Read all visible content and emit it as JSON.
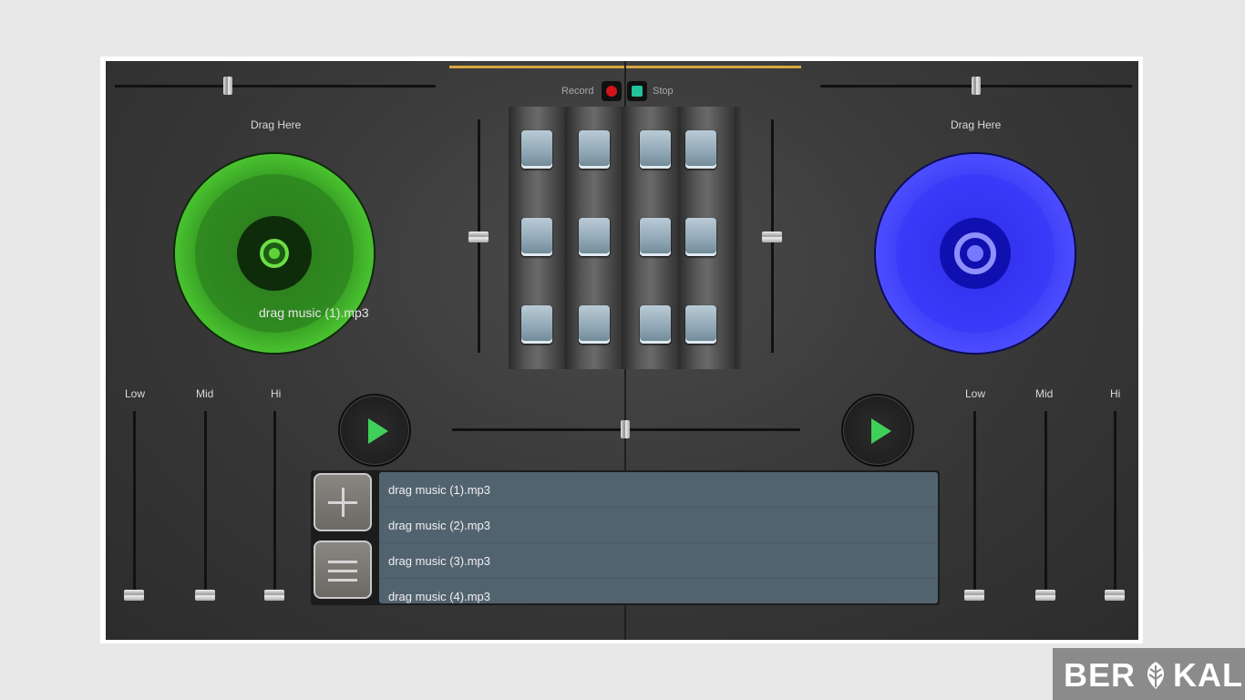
{
  "deck_left": {
    "drag_label": "Drag Here",
    "track_name": "drag music (1).mp3",
    "disc_color": "#3aa226"
  },
  "deck_right": {
    "drag_label": "Drag Here",
    "disc_color": "#3a3afa"
  },
  "controls": {
    "record_label": "Record",
    "stop_label": "Stop",
    "record_color": "#d2141a",
    "stop_color": "#22c39a"
  },
  "eq_left": {
    "low": "Low",
    "mid": "Mid",
    "hi": "Hi"
  },
  "eq_right": {
    "low": "Low",
    "mid": "Mid",
    "hi": "Hi"
  },
  "playlist": {
    "items": [
      "drag music (1).mp3",
      "drag music (2).mp3",
      "drag music (3).mp3",
      "drag music (4).mp3"
    ]
  },
  "watermark": {
    "left": "BER",
    "right": "KAL"
  },
  "icons": {
    "add": "plus-icon",
    "list": "menu-icon",
    "play": "play-icon",
    "watermark_logo": "leaf-logo-icon"
  }
}
